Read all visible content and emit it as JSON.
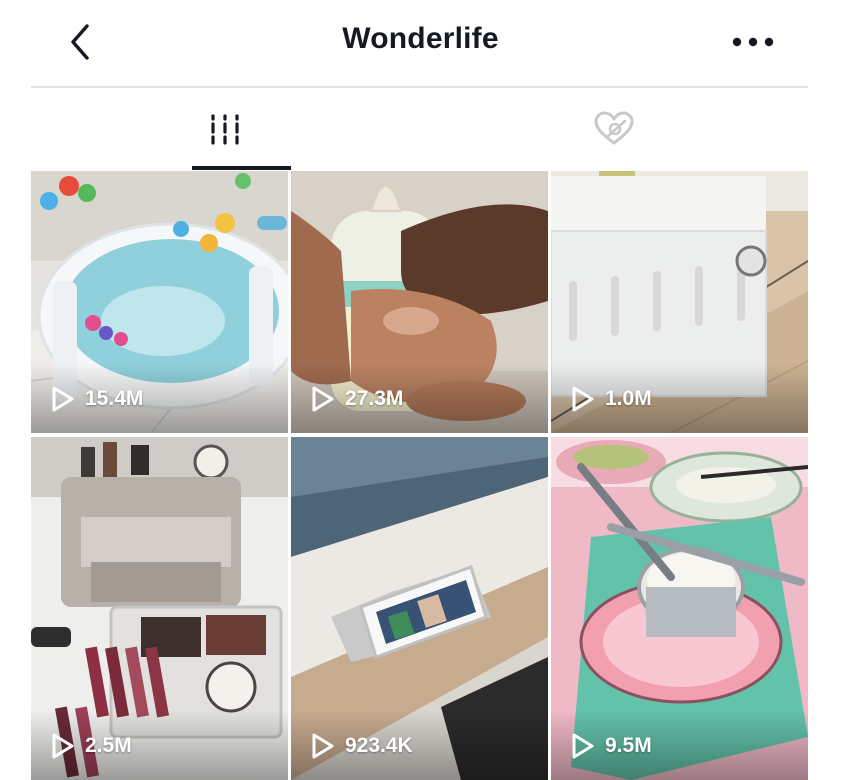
{
  "header": {
    "title": "Wonderlife",
    "back_icon": "chevron-left-icon",
    "more_icon": "more-horizontal-icon"
  },
  "tabs": [
    {
      "name": "videos",
      "icon": "grid-bars-icon",
      "active": true
    },
    {
      "name": "liked",
      "icon": "heart-hidden-icon",
      "active": false
    }
  ],
  "videos": [
    {
      "views": "15.4M",
      "scene": "foldable baby bathtub with blue water and toys"
    },
    {
      "views": "27.3M",
      "scene": "hand holding baby milk bottle"
    },
    {
      "views": "1.0M",
      "scene": "white plastic storage rack on marble floor"
    },
    {
      "views": "2.5M",
      "scene": "makeup organizer drawers with lipsticks"
    },
    {
      "views": "923.4K",
      "scene": "phone mounted on car dashboard"
    },
    {
      "views": "9.5M",
      "scene": "potato ricer pressing rice on pink plate"
    }
  ],
  "colors": {
    "text": "#161823",
    "divider": "#e3e3e4",
    "inactive_icon": "#c9c9cc"
  }
}
